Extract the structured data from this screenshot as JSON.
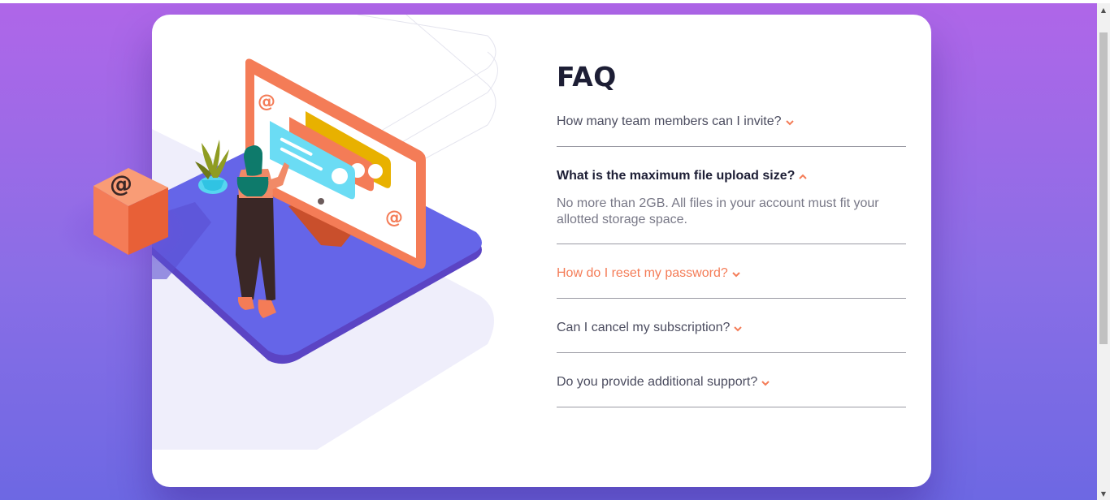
{
  "page": {
    "title": "FAQ"
  },
  "colors": {
    "background_top": "#af66e8",
    "background_bottom": "#6d68e3",
    "title": "#1d1e35",
    "text": "#4b4c5f",
    "answer": "#787887",
    "accent": "#f47c57",
    "divider": "#9a9aa3"
  },
  "illustration": {
    "scene": "woman-at-online-monitor",
    "box_symbol": "@"
  },
  "faq": [
    {
      "question": "How many team members can I invite?",
      "state": "collapsed",
      "icon": "chevron-down-icon"
    },
    {
      "question": "What is the maximum file upload size?",
      "state": "expanded",
      "icon": "chevron-up-icon",
      "answer": "No more than 2GB. All files in your account must fit your allotted storage space."
    },
    {
      "question": "How do I reset my password?",
      "state": "hover",
      "icon": "chevron-down-icon"
    },
    {
      "question": "Can I cancel my subscription?",
      "state": "collapsed",
      "icon": "chevron-down-icon"
    },
    {
      "question": "Do you provide additional support?",
      "state": "collapsed",
      "icon": "chevron-down-icon"
    }
  ],
  "scrollbar": {
    "up_icon": "scroll-up-arrow-icon",
    "down_icon": "scroll-down-arrow-icon"
  }
}
